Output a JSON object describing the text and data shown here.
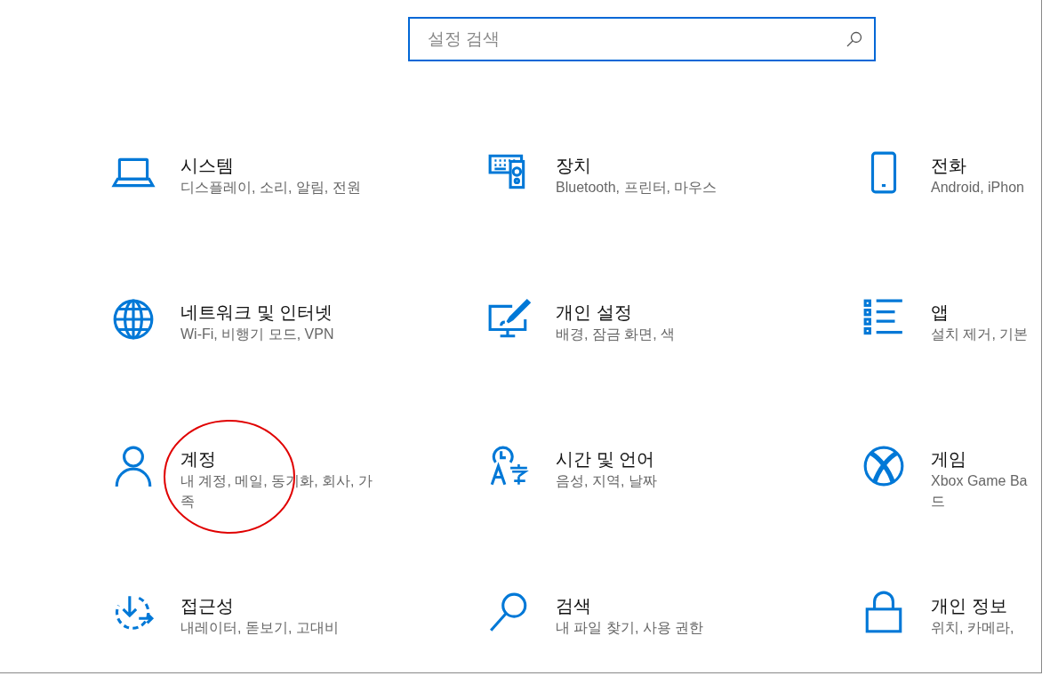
{
  "search": {
    "placeholder": "설정 검색"
  },
  "categories": [
    {
      "title": "시스템",
      "description": [
        "디스플레이, 소리, 알림, 전원"
      ],
      "circled": false
    },
    {
      "title": "장치",
      "description": [
        "Bluetooth, 프린터, 마우스"
      ],
      "circled": false
    },
    {
      "title": "전화",
      "description": [
        "Android, iPhon"
      ],
      "circled": false
    },
    {
      "title": "네트워크 및 인터넷",
      "description": [
        "Wi-Fi, 비행기 모드, VPN"
      ],
      "circled": false
    },
    {
      "title": "개인 설정",
      "description": [
        "배경, 잠금 화면, 색"
      ],
      "circled": false
    },
    {
      "title": "앱",
      "description": [
        "설치 제거, 기본"
      ],
      "circled": false
    },
    {
      "title": "계정",
      "description": [
        "내 계정, 메일, 동기화, 회사, 가",
        "족"
      ],
      "circled": true
    },
    {
      "title": "시간 및 언어",
      "description": [
        "음성, 지역, 날짜"
      ],
      "circled": false
    },
    {
      "title": "게임",
      "description": [
        "Xbox Game Ba",
        "드"
      ],
      "circled": false
    },
    {
      "title": "접근성",
      "description": [
        "내레이터, 돋보기, 고대비"
      ],
      "circled": false
    },
    {
      "title": "검색",
      "description": [
        "내 파일 찾기, 사용 권한"
      ],
      "circled": false
    },
    {
      "title": "개인 정보",
      "description": [
        "위치, 카메라,"
      ],
      "circled": false
    }
  ]
}
